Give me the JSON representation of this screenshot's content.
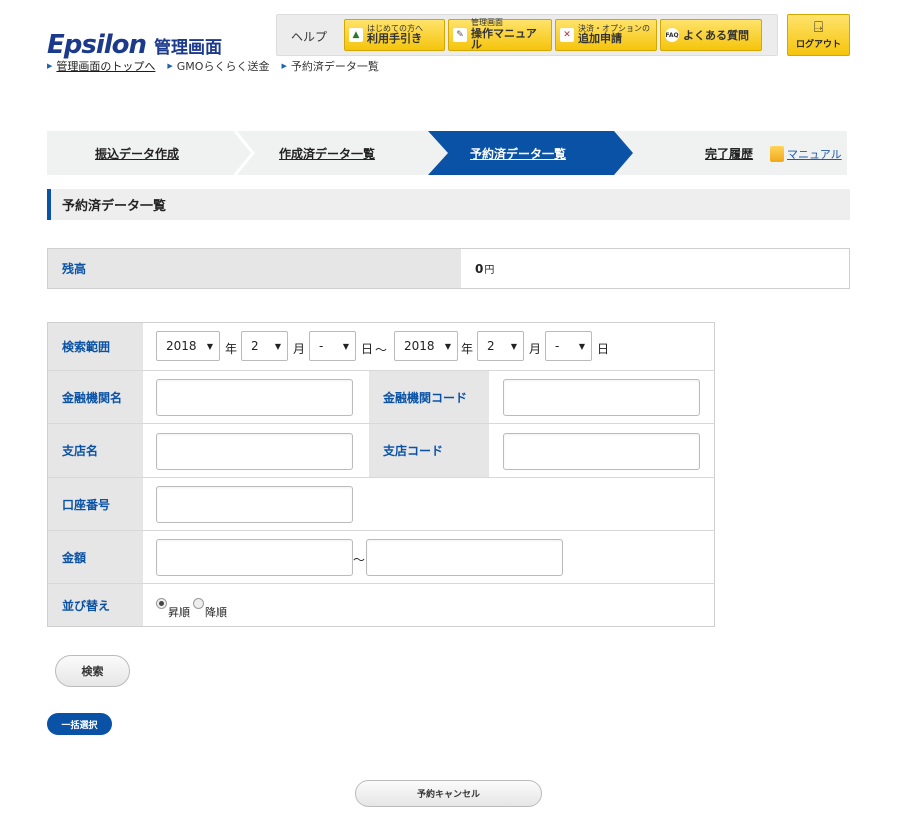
{
  "logo": {
    "mark": "Epsilon",
    "subtitle": "管理画面"
  },
  "help": {
    "label": "ヘルプ",
    "buttons": [
      {
        "small": "はじめての方へ",
        "big": "利用手引き"
      },
      {
        "small": "管理画面",
        "big": "操作マニュアル"
      },
      {
        "small": "決済・オプションの",
        "big": "追加申請"
      },
      {
        "one": "よくある質問"
      }
    ]
  },
  "logout": {
    "label": "ログアウト"
  },
  "breadcrumb": [
    {
      "label": "管理画面のトップへ"
    },
    {
      "label": "GMOらくらく送金"
    },
    {
      "label": "予約済データ一覧"
    }
  ],
  "steps": [
    {
      "label": "振込データ作成"
    },
    {
      "label": "作成済データ一覧"
    },
    {
      "label": "予約済データ一覧"
    },
    {
      "label": "完了履歴"
    }
  ],
  "manual": {
    "label": "マニュアル"
  },
  "section": {
    "title": "予約済データ一覧"
  },
  "balance": {
    "label": "残高",
    "value": "0",
    "unit": "円"
  },
  "search": {
    "range_label": "検索範囲",
    "from": {
      "year": "2018",
      "month": "2",
      "day": "-"
    },
    "to": {
      "year": "2018",
      "month": "2",
      "day": "-"
    },
    "units": {
      "year": "年",
      "month": "月",
      "day": "日",
      "tilde": "～"
    },
    "bank_name_label": "金融機関名",
    "bank_code_label": "金融機関コード",
    "branch_name_label": "支店名",
    "branch_code_label": "支店コード",
    "account_label": "口座番号",
    "amount_label": "金額",
    "amount_tilde": "～",
    "sort_label": "並び替え",
    "sort_asc": "昇順",
    "sort_desc": "降順"
  },
  "buttons": {
    "search": "検索",
    "bulk_select": "一括選択",
    "cancel_reservation": "予約キャンセル"
  },
  "colors": {
    "primary": "#0a52a5",
    "help_yellow": "#f5c40c"
  }
}
